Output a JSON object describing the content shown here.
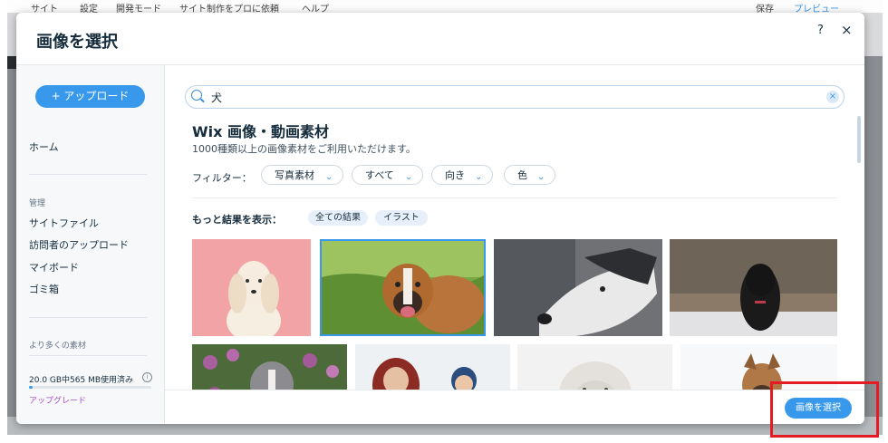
{
  "background_editor": {
    "menu": [
      "サイト",
      "設定",
      "開発モード",
      "サイト制作をプロに依頼",
      "ヘルプ"
    ],
    "menu_right": [
      "保存",
      "プレビュー"
    ]
  },
  "modal": {
    "title": "画像を選択",
    "help_label": "?",
    "close_label": "×",
    "select_button": "画像を選択"
  },
  "sidebar": {
    "upload_button": "+ アップロード",
    "home": "ホーム",
    "manage_heading": "管理",
    "items": [
      "サイトファイル",
      "訪問者のアップロード",
      "マイボード",
      "ゴミ箱"
    ],
    "more_heading": "より多くの素材",
    "storage_text": "20.0 GB中565 MB使用済み",
    "storage_used_fraction": 0.028,
    "info_icon": "i",
    "upgrade_link": "アップグレード"
  },
  "search": {
    "value": "犬",
    "clear_label": "×"
  },
  "section": {
    "title": "Wix 画像・動画素材",
    "subtitle": "1000種類以上の画像素材をご利用いただけます。"
  },
  "filters": {
    "label": "フィルター：",
    "options": [
      "写真素材",
      "すべて",
      "向き",
      "色"
    ],
    "chevron": "⌄"
  },
  "more_results": {
    "label": "もっと結果を表示：",
    "tags": [
      "全ての結果",
      "イラスト"
    ]
  },
  "colors": {
    "accent": "#3899ec",
    "highlight": "#e41b23"
  }
}
